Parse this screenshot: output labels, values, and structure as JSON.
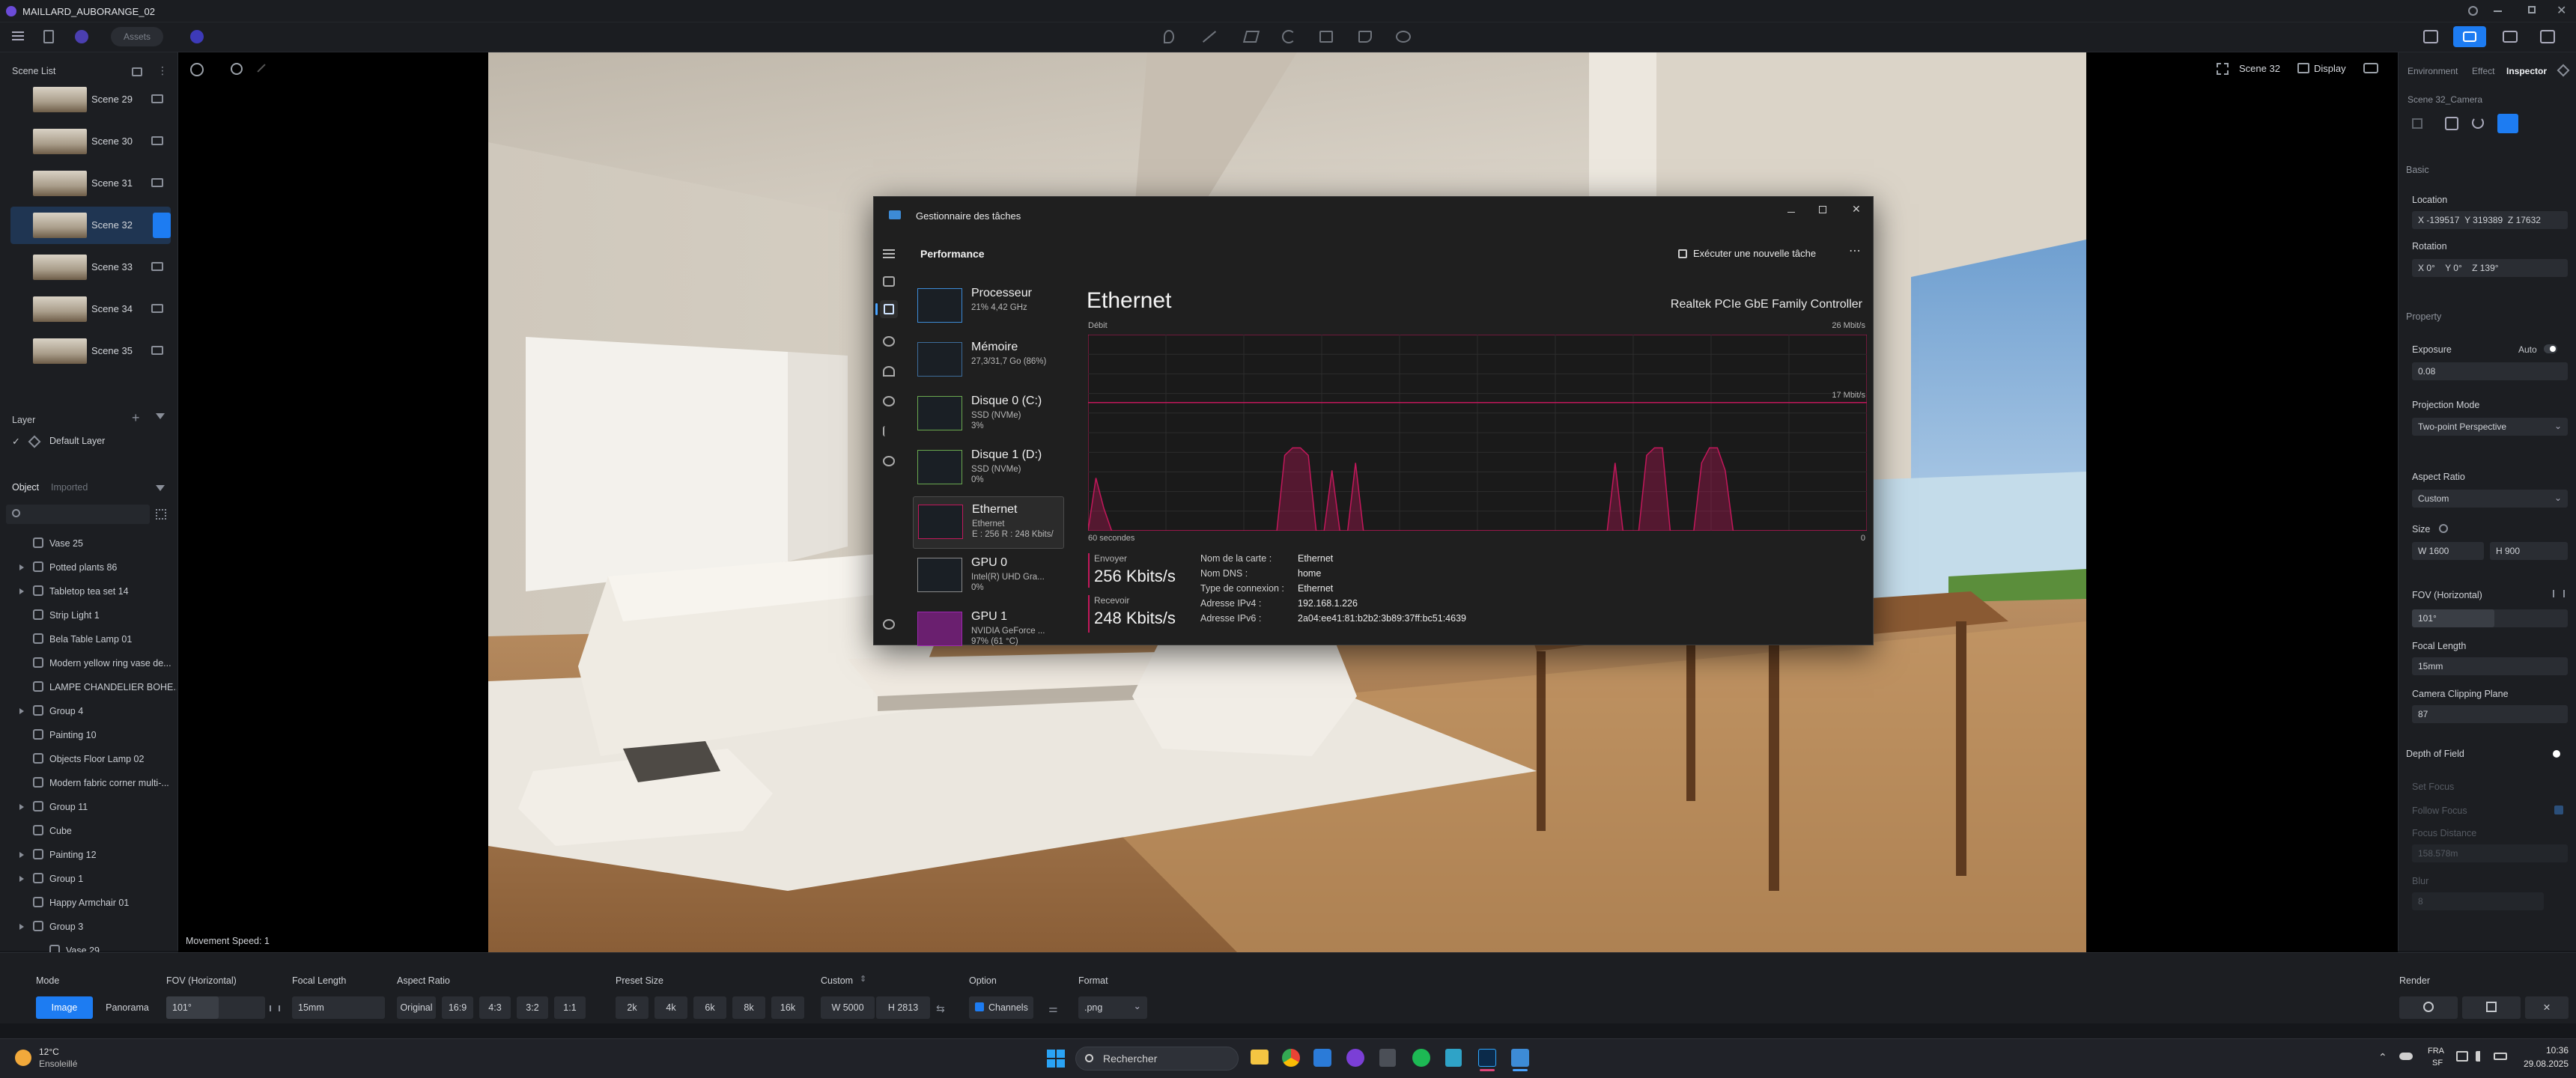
{
  "app": {
    "title": "MAILLARD_AUBORANGE_02",
    "assets_label": "Assets"
  },
  "viewport": {
    "scene_label": "Scene 32",
    "display_label": "Display",
    "movement_speed": "Movement Speed: 1"
  },
  "scene_list": {
    "title": "Scene List",
    "items": [
      {
        "label": "Scene 29"
      },
      {
        "label": "Scene 30"
      },
      {
        "label": "Scene 31"
      },
      {
        "label": "Scene 32"
      },
      {
        "label": "Scene 33"
      },
      {
        "label": "Scene 34"
      },
      {
        "label": "Scene 35"
      }
    ]
  },
  "layer": {
    "title": "Layer",
    "default_layer": "Default Layer"
  },
  "object_tabs": {
    "object": "Object",
    "imported": "Imported"
  },
  "objects": [
    {
      "label": "Vase 25",
      "expand": false,
      "indent": false
    },
    {
      "label": "Potted plants 86",
      "expand": true,
      "indent": false
    },
    {
      "label": "Tabletop tea set 14",
      "expand": true,
      "indent": false
    },
    {
      "label": "Strip Light 1",
      "expand": false,
      "indent": false
    },
    {
      "label": "Bela Table Lamp 01",
      "expand": false,
      "indent": false
    },
    {
      "label": "Modern yellow ring vase de...",
      "expand": false,
      "indent": false
    },
    {
      "label": "LAMPE CHANDELIER BOHE...",
      "expand": false,
      "indent": false
    },
    {
      "label": "Group 4",
      "expand": true,
      "indent": false
    },
    {
      "label": "Painting 10",
      "expand": false,
      "indent": false
    },
    {
      "label": "Objects Floor Lamp 02",
      "expand": false,
      "indent": false
    },
    {
      "label": "Modern fabric corner multi-...",
      "expand": false,
      "indent": false
    },
    {
      "label": "Group 11",
      "expand": true,
      "indent": false
    },
    {
      "label": "Cube",
      "expand": false,
      "indent": false
    },
    {
      "label": "Painting 12",
      "expand": true,
      "indent": false
    },
    {
      "label": "Group 1",
      "expand": true,
      "indent": false
    },
    {
      "label": "Happy Armchair 01",
      "expand": false,
      "indent": false
    },
    {
      "label": "Group 3",
      "expand": true,
      "indent": false
    },
    {
      "label": "Vase 29",
      "expand": false,
      "indent": true
    }
  ],
  "right_panel": {
    "tabs": [
      "Environment",
      "Effect",
      "Inspector"
    ],
    "camera_name": "Scene 32_Camera",
    "basic": "Basic",
    "location": "Location",
    "loc_x": "X -139517",
    "loc_y": "Y 319389",
    "loc_z": "Z 17632",
    "rotation": "Rotation",
    "rot_x": "X 0°",
    "rot_y": "Y 0°",
    "rot_z": "Z 139°",
    "property": "Property",
    "exposure": "Exposure",
    "exposure_auto": "Auto",
    "exposure_value": "0.08",
    "projection_mode": "Projection Mode",
    "projection_value": "Two-point Perspective",
    "aspect_ratio": "Aspect Ratio",
    "aspect_value": "Custom",
    "size": "Size",
    "size_w": "W 1600",
    "size_h": "H 900",
    "fov": "FOV (Horizontal)",
    "fov_value": "101°",
    "focal_length": "Focal Length",
    "focal_value": "15mm",
    "clipping": "Camera Clipping Plane",
    "clipping_value": "87",
    "dof": "Depth of Field",
    "set_focus": "Set Focus",
    "follow_focus": "Follow Focus",
    "focus_distance": "Focus Distance",
    "focus_distance_value": "158.578m",
    "blur": "Blur",
    "blur_value": "8"
  },
  "bottom_bar": {
    "mode": "Mode",
    "mode_image": "Image",
    "mode_panorama": "Panorama",
    "fov": "FOV (Horizontal)",
    "fov_value": "101°",
    "focal": "Focal Length",
    "focal_value": "15mm",
    "aspect": "Aspect Ratio",
    "aspect_options": [
      "Original",
      "16:9",
      "4:3",
      "3:2",
      "1:1"
    ],
    "preset": "Preset Size",
    "preset_options": [
      "2k",
      "4k",
      "6k",
      "8k",
      "16k"
    ],
    "custom": "Custom",
    "custom_w": "W 5000",
    "custom_h": "H 2813",
    "option": "Option",
    "channels": "Channels",
    "format": "Format",
    "format_value": ".png",
    "render": "Render"
  },
  "task_manager": {
    "title": "Gestionnaire des tâches",
    "section": "Performance",
    "new_task": "Exécuter une nouvelle tâche",
    "items": [
      {
        "name": "Processeur",
        "l1": "21% 4,42 GHz",
        "l2": ""
      },
      {
        "name": "Mémoire",
        "l1": "27,3/31,7 Go (86%)",
        "l2": ""
      },
      {
        "name": "Disque 0 (C:)",
        "l1": "SSD (NVMe)",
        "l2": "3%"
      },
      {
        "name": "Disque 1 (D:)",
        "l1": "SSD (NVMe)",
        "l2": "0%"
      },
      {
        "name": "Ethernet",
        "l1": "Ethernet",
        "l2": "E : 256 R : 248 Kbits/"
      },
      {
        "name": "GPU 0",
        "l1": "Intel(R) UHD Gra...",
        "l2": "0%"
      },
      {
        "name": "GPU 1",
        "l1": "NVIDIA GeForce ...",
        "l2": "97% (61 °C)"
      }
    ],
    "heading": "Ethernet",
    "adapter": "Realtek PCIe GbE Family Controller",
    "debit": "Débit",
    "max_label": "26 Mbit/s",
    "mid_label": "17 Mbit/s",
    "time_label": "60 secondes",
    "zero_label": "0",
    "send_label": "Envoyer",
    "send_value": "256 Kbits/s",
    "recv_label": "Recevoir",
    "recv_value": "248 Kbits/s",
    "props": [
      {
        "k": "Nom de la carte :",
        "v": "Ethernet"
      },
      {
        "k": "Nom DNS :",
        "v": "home"
      },
      {
        "k": "Type de connexion :",
        "v": "Ethernet"
      },
      {
        "k": "Adresse IPv4 :",
        "v": "192.168.1.226"
      },
      {
        "k": "Adresse IPv6 :",
        "v": "2a04:ee41:81:b2b2:3b89:37ff:bc51:4639"
      }
    ]
  },
  "chart_data": {
    "type": "area",
    "title": "Ethernet",
    "ylabel": "Débit",
    "ylim": [
      0,
      26
    ],
    "y_unit": "Mbit/s",
    "x_span": "60 secondes",
    "reference_line": 17,
    "series": [
      {
        "values": [
          0,
          7,
          3,
          0,
          0,
          0,
          0,
          0,
          0,
          0,
          0,
          0,
          0,
          0,
          0,
          0,
          0,
          0,
          0,
          0,
          0,
          0,
          0,
          0,
          0,
          10,
          11,
          11,
          10,
          0,
          0,
          8,
          0,
          0,
          9,
          0,
          0,
          0,
          0,
          0,
          0,
          0,
          0,
          0,
          0,
          0,
          0,
          0,
          0,
          0,
          0,
          0,
          0,
          0,
          0,
          0,
          0,
          0,
          0,
          0,
          0,
          0,
          0,
          0,
          0,
          0,
          0,
          9,
          0,
          0,
          0,
          10,
          11,
          11,
          0,
          0,
          0,
          0,
          9,
          11,
          11,
          8,
          0,
          0,
          0,
          0,
          0,
          0,
          0,
          0,
          0,
          0,
          0,
          0,
          0,
          0,
          0,
          0,
          0,
          0
        ]
      }
    ]
  },
  "taskbar": {
    "weather_temp": "12°C",
    "weather_desc": "Ensoleillé",
    "search": "Rechercher",
    "lang1": "FRA",
    "lang2": "SF",
    "time": "10:36",
    "date": "29.08.2025"
  },
  "colors": {
    "accent": "#1d7cf2",
    "chart": "#c2185b",
    "taskman_bg": "#1f1f1f"
  }
}
